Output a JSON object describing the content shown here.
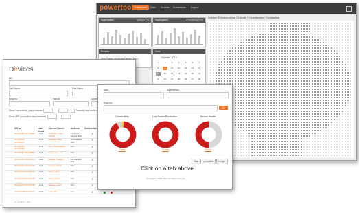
{
  "back_window": {
    "brand": "powertools",
    "nav_tabs": [
      "Dashboard",
      "Data",
      "Devices",
      "Substations",
      "Logout"
    ],
    "panels": {
      "aggregated_left": {
        "title": "Aggregated",
        "subtitle": "Voltage (V)"
      },
      "aggregated_right": {
        "title": "Aggregated",
        "subtitle": "Frequency (Hz)"
      },
      "presets": {
        "title": "Presets",
        "text": "You have no saved searches."
      },
      "date": {
        "title": "Date",
        "month": "October, 2012"
      }
    },
    "calendar_days": [
      "1",
      "2",
      "3",
      "4",
      "5",
      "6",
      "7",
      "8",
      "9",
      "10",
      "11",
      "12",
      "13",
      "14",
      "15",
      "16",
      "17",
      "18",
      "19",
      "20",
      "21",
      "22",
      "23",
      "24",
      "25",
      "26",
      "27",
      "28"
    ],
    "map_info": "Selected 90 devices across 18 circuits + 0 transformers + 0 substations"
  },
  "left_window": {
    "title_prefix": "D",
    "title_accent": "e",
    "title_rest": "vices",
    "filters": {
      "uid_label": "UID",
      "last_name_label": "Last Name",
      "first_name_label": "First Name",
      "regions_label": "Regions",
      "islands_label": "Islands",
      "aggregations_label": "Aggregations",
      "last_heard_label": "Show Connectivity (days between",
      "currently_label": "Currently has health status",
      "production_label": "Show LPP (production days between"
    },
    "columns": [
      "UID ▲",
      "Last Heard",
      "Current Owner",
      "Address",
      "Connectivity",
      "Low Power Production",
      "Device Health"
    ],
    "rows": [
      {
        "uid": "04C3A9B1 04C3A9B0",
        "last": "NaN",
        "owner": "Anderson, Sara Kahale",
        "addr": "1405 Ala Moana Blvd",
        "sig": "∧"
      },
      {
        "uid": "04C3A9C2 04C3A9C1",
        "last": "NaN",
        "owner": "Kealoha, Mika",
        "addr": "91 Kalakaua Ave",
        "sig": "∨"
      },
      {
        "uid": "04C3A9D4 04C3A9D3",
        "last": "NaN",
        "owner": "Lee, Daniel Haina",
        "addr": "N/A",
        "sig": "∧"
      },
      {
        "uid": "04C3A9E7 04C3A9E6",
        "last": "NaN",
        "owner": "Nakamura, Lisa",
        "addr": "N/A",
        "sig": "∨"
      },
      {
        "uid": "04C3A9F1 04C3A9F0",
        "last": "NaN",
        "owner": "Kahale, Noelani",
        "addr": "1st Waialae Ave",
        "sig": "∧"
      },
      {
        "uid": "04C3AA02 04C3AA01",
        "last": "NaN",
        "owner": "Gomes, Peter",
        "addr": "N/A",
        "sig": "∨"
      },
      {
        "uid": "04C3AA15 04C3AA14",
        "last": "NaN",
        "owner": "Silva, Maria",
        "addr": "N/A",
        "sig": "∧"
      },
      {
        "uid": "04C3AA26 04C3AA25",
        "last": "NaN",
        "owner": "Wong, Kevin",
        "addr": "N/A",
        "sig": "∨"
      },
      {
        "uid": "04C3AA37 04C3AA36",
        "last": "NaN",
        "owner": "Akana, Leilani",
        "addr": "N/A",
        "sig": "∧"
      },
      {
        "uid": "04C3AA48 04C3AA47",
        "last": "NaN",
        "owner": "Fujii, Alan",
        "addr": "N/A",
        "sig": "∨"
      }
    ],
    "pager": "‹ 1 2 3 4 5 … 23 ›"
  },
  "front_window": {
    "labels": {
      "island": "Islas",
      "aggregation": "Aggregation",
      "region": "Regions"
    },
    "go_label": "Go",
    "donuts": [
      {
        "title": "Connectivity",
        "link": "Subtle",
        "red_fraction": 0.92
      },
      {
        "title": "Low Power Production",
        "link": "Subtle",
        "red_fraction": 1.0
      },
      {
        "title": "Device Health",
        "link": "Subtle",
        "red_fraction": 0.5
      }
    ],
    "buttons": [
      "Map",
      "production",
      "Ledger"
    ],
    "click_text": "Click on a tab above",
    "copyright": "Copyright © 2012 Data. All rights reserved."
  },
  "colors": {
    "accent": "#e8772e",
    "alert": "#d42020",
    "donut_red": "#cc1b1b"
  }
}
